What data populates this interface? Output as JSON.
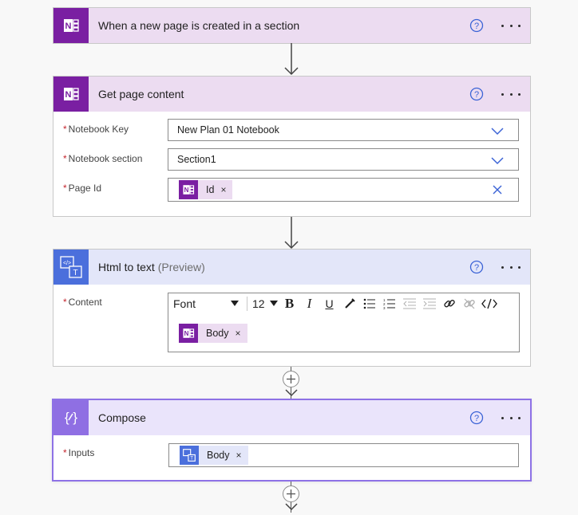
{
  "colors": {
    "onenote": "#7a1fa2",
    "html_to_text": "#4b6fdc",
    "compose": "#8f6fe3",
    "required": "#c4262e"
  },
  "trigger": {
    "title": "When a new page is created in a section",
    "icon": "onenote-icon"
  },
  "get_page": {
    "title": "Get page content",
    "icon": "onenote-icon",
    "fields": [
      {
        "label": "Notebook Key",
        "value": "New Plan 01 Notebook"
      },
      {
        "label": "Notebook section",
        "value": "Section1"
      },
      {
        "label": "Page Id",
        "token": "Id"
      }
    ]
  },
  "html_to_text": {
    "title": "Html to text",
    "preview": "(Preview)",
    "icon": "html-to-text-icon",
    "content_label": "Content",
    "font_value": "Font",
    "size_value": "12",
    "token": "Body"
  },
  "compose": {
    "title": "Compose",
    "icon": "compose-icon",
    "inputs_label": "Inputs",
    "token": "Body"
  },
  "required_mark": "*",
  "token_remove": "×"
}
